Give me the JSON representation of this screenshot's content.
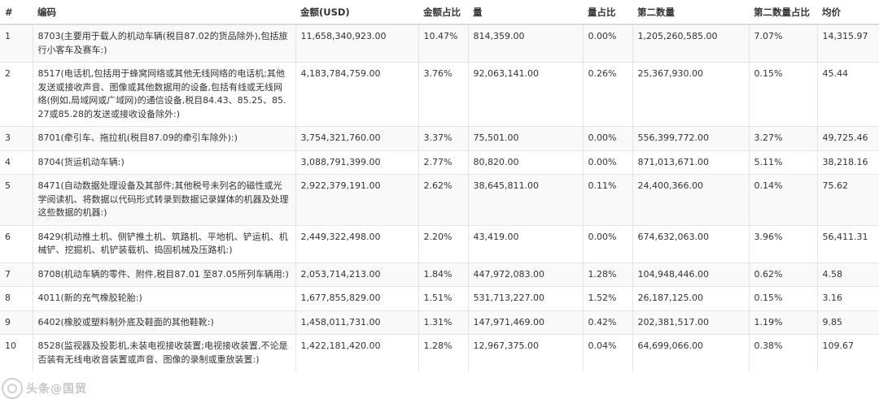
{
  "headers": {
    "idx": "#",
    "code": "编码",
    "amount": "金额(USD)",
    "amount_pct": "金额占比",
    "qty": "量",
    "qty_pct": "量占比",
    "qty2": "第二数量",
    "qty2_pct": "第二数量占比",
    "avg": "均价"
  },
  "rows": [
    {
      "idx": "1",
      "code": "8703(主要用于载人的机动车辆(税目87.02的货品除外),包括旅行小客车及赛车:)",
      "amount": "11,658,340,923.00",
      "amount_pct": "10.47%",
      "qty": "814,359.00",
      "qty_pct": "0.00%",
      "qty2": "1,205,260,585.00",
      "qty2_pct": "7.07%",
      "avg": "14,315.97"
    },
    {
      "idx": "2",
      "code": "8517(电话机,包括用于蜂窝网络或其他无线网络的电话机;其他发送或接收声音、图像或其他数据用的设备,包括有线或无线网络(例如,局域网或广域网)的通信设备,税目84.43、85.25、85.27或85.28的发送或接收设备除外:)",
      "amount": "4,183,784,759.00",
      "amount_pct": "3.76%",
      "qty": "92,063,141.00",
      "qty_pct": "0.26%",
      "qty2": "25,367,930.00",
      "qty2_pct": "0.15%",
      "avg": "45.44"
    },
    {
      "idx": "3",
      "code": "8701(牵引车、拖拉机(税目87.09的牵引车除外):)",
      "amount": "3,754,321,760.00",
      "amount_pct": "3.37%",
      "qty": "75,501.00",
      "qty_pct": "0.00%",
      "qty2": "556,399,772.00",
      "qty2_pct": "3.27%",
      "avg": "49,725.46"
    },
    {
      "idx": "4",
      "code": "8704(货运机动车辆:)",
      "amount": "3,088,791,399.00",
      "amount_pct": "2.77%",
      "qty": "80,820.00",
      "qty_pct": "0.00%",
      "qty2": "871,013,671.00",
      "qty2_pct": "5.11%",
      "avg": "38,218.16"
    },
    {
      "idx": "5",
      "code": "8471(自动数据处理设备及其部件;其他税号未列名的磁性或光学阅读机、将数据以代码形式转录到数据记录媒体的机器及处理这些数据的机器:)",
      "amount": "2,922,379,191.00",
      "amount_pct": "2.62%",
      "qty": "38,645,811.00",
      "qty_pct": "0.11%",
      "qty2": "24,400,366.00",
      "qty2_pct": "0.14%",
      "avg": "75.62"
    },
    {
      "idx": "6",
      "code": "8429(机动推土机、侧铲推土机、筑路机、平地机、铲运机、机械铲、挖掘机、机铲装载机、捣固机械及压路机:)",
      "amount": "2,449,322,498.00",
      "amount_pct": "2.20%",
      "qty": "43,419.00",
      "qty_pct": "0.00%",
      "qty2": "674,632,063.00",
      "qty2_pct": "3.96%",
      "avg": "56,411.31"
    },
    {
      "idx": "7",
      "code": "8708(机动车辆的零件、附件,税目87.01 至87.05所列车辆用:)",
      "amount": "2,053,714,213.00",
      "amount_pct": "1.84%",
      "qty": "447,972,083.00",
      "qty_pct": "1.28%",
      "qty2": "104,948,446.00",
      "qty2_pct": "0.62%",
      "avg": "4.58"
    },
    {
      "idx": "8",
      "code": "4011(新的充气橡胶轮胎:)",
      "amount": "1,677,855,829.00",
      "amount_pct": "1.51%",
      "qty": "531,713,227.00",
      "qty_pct": "1.52%",
      "qty2": "26,187,125.00",
      "qty2_pct": "0.15%",
      "avg": "3.16"
    },
    {
      "idx": "9",
      "code": "6402(橡胶或塑料制外底及鞋面的其他鞋靴:)",
      "amount": "1,458,011,731.00",
      "amount_pct": "1.31%",
      "qty": "147,971,469.00",
      "qty_pct": "0.42%",
      "qty2": "202,381,517.00",
      "qty2_pct": "1.19%",
      "avg": "9.85"
    },
    {
      "idx": "10",
      "code": "8528(监视器及投影机,未装电视接收装置;电视接收装置,不论是否装有无线电收音装置或声音、图像的录制或重放装置:)",
      "amount": "1,422,181,420.00",
      "amount_pct": "1.28%",
      "qty": "12,967,375.00",
      "qty_pct": "0.04%",
      "qty2": "64,699,066.00",
      "qty2_pct": "0.38%",
      "avg": "109.67"
    }
  ],
  "watermark": {
    "text": "头条@国贸",
    "icon": "watermark-logo-icon"
  }
}
